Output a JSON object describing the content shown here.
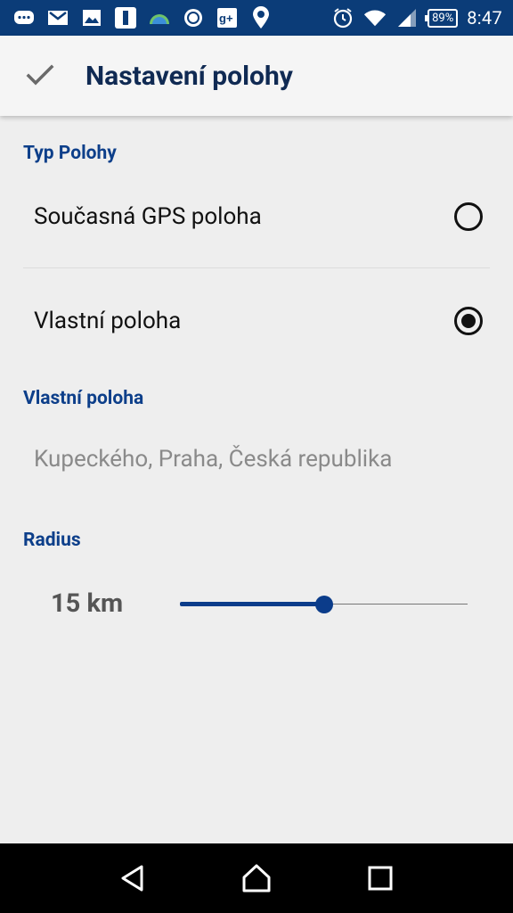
{
  "status_bar": {
    "time": "8:47",
    "battery": "89%",
    "icons": [
      "messenger-icon",
      "gmail-icon",
      "gallery-icon",
      "app-icon",
      "weather-icon",
      "app-icon",
      "google-plus-icon",
      "location-icon",
      "alarm-icon",
      "wifi-icon",
      "signal-icon",
      "battery-icon"
    ]
  },
  "app_bar": {
    "title": "Nastavení polohy",
    "confirm_icon": "check-icon"
  },
  "location_type": {
    "header": "Typ Polohy",
    "options": [
      {
        "label": "Současná GPS poloha",
        "selected": false
      },
      {
        "label": "Vlastní poloha",
        "selected": true
      }
    ]
  },
  "custom_location": {
    "header": "Vlastní poloha",
    "value": "Kupeckého, Praha, Česká republika"
  },
  "radius": {
    "header": "Radius",
    "value_label": "15 km",
    "slider_fraction": 0.5
  },
  "nav_bar": {
    "buttons": [
      "back-icon",
      "home-icon",
      "recents-icon"
    ]
  },
  "colors": {
    "primary": "#0b3c78",
    "accent": "#0d3f8a",
    "background": "#eeeeee"
  }
}
